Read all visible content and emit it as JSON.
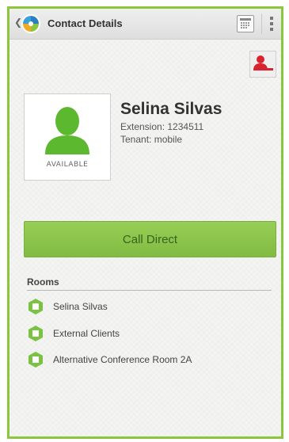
{
  "header": {
    "title": "Contact Details",
    "icons": {
      "back": "chevron-left-icon",
      "logo": "app-logo-icon",
      "calendar": "calendar-icon",
      "overflow": "overflow-menu-icon"
    }
  },
  "contact": {
    "name": "Selina Silvas",
    "extension": "Extension: 1234511",
    "tenant": "Tenant: mobile",
    "status": "AVAILABLE"
  },
  "actions": {
    "call_label": "Call Direct"
  },
  "rooms": {
    "heading": "Rooms",
    "items": [
      {
        "label": "Selina Silvas"
      },
      {
        "label": "External Clients"
      },
      {
        "label": "Alternative Conference Room 2A"
      }
    ]
  },
  "colors": {
    "accent": "#8cc63f",
    "presence": "#5cb82e",
    "alert": "#d9232e"
  }
}
